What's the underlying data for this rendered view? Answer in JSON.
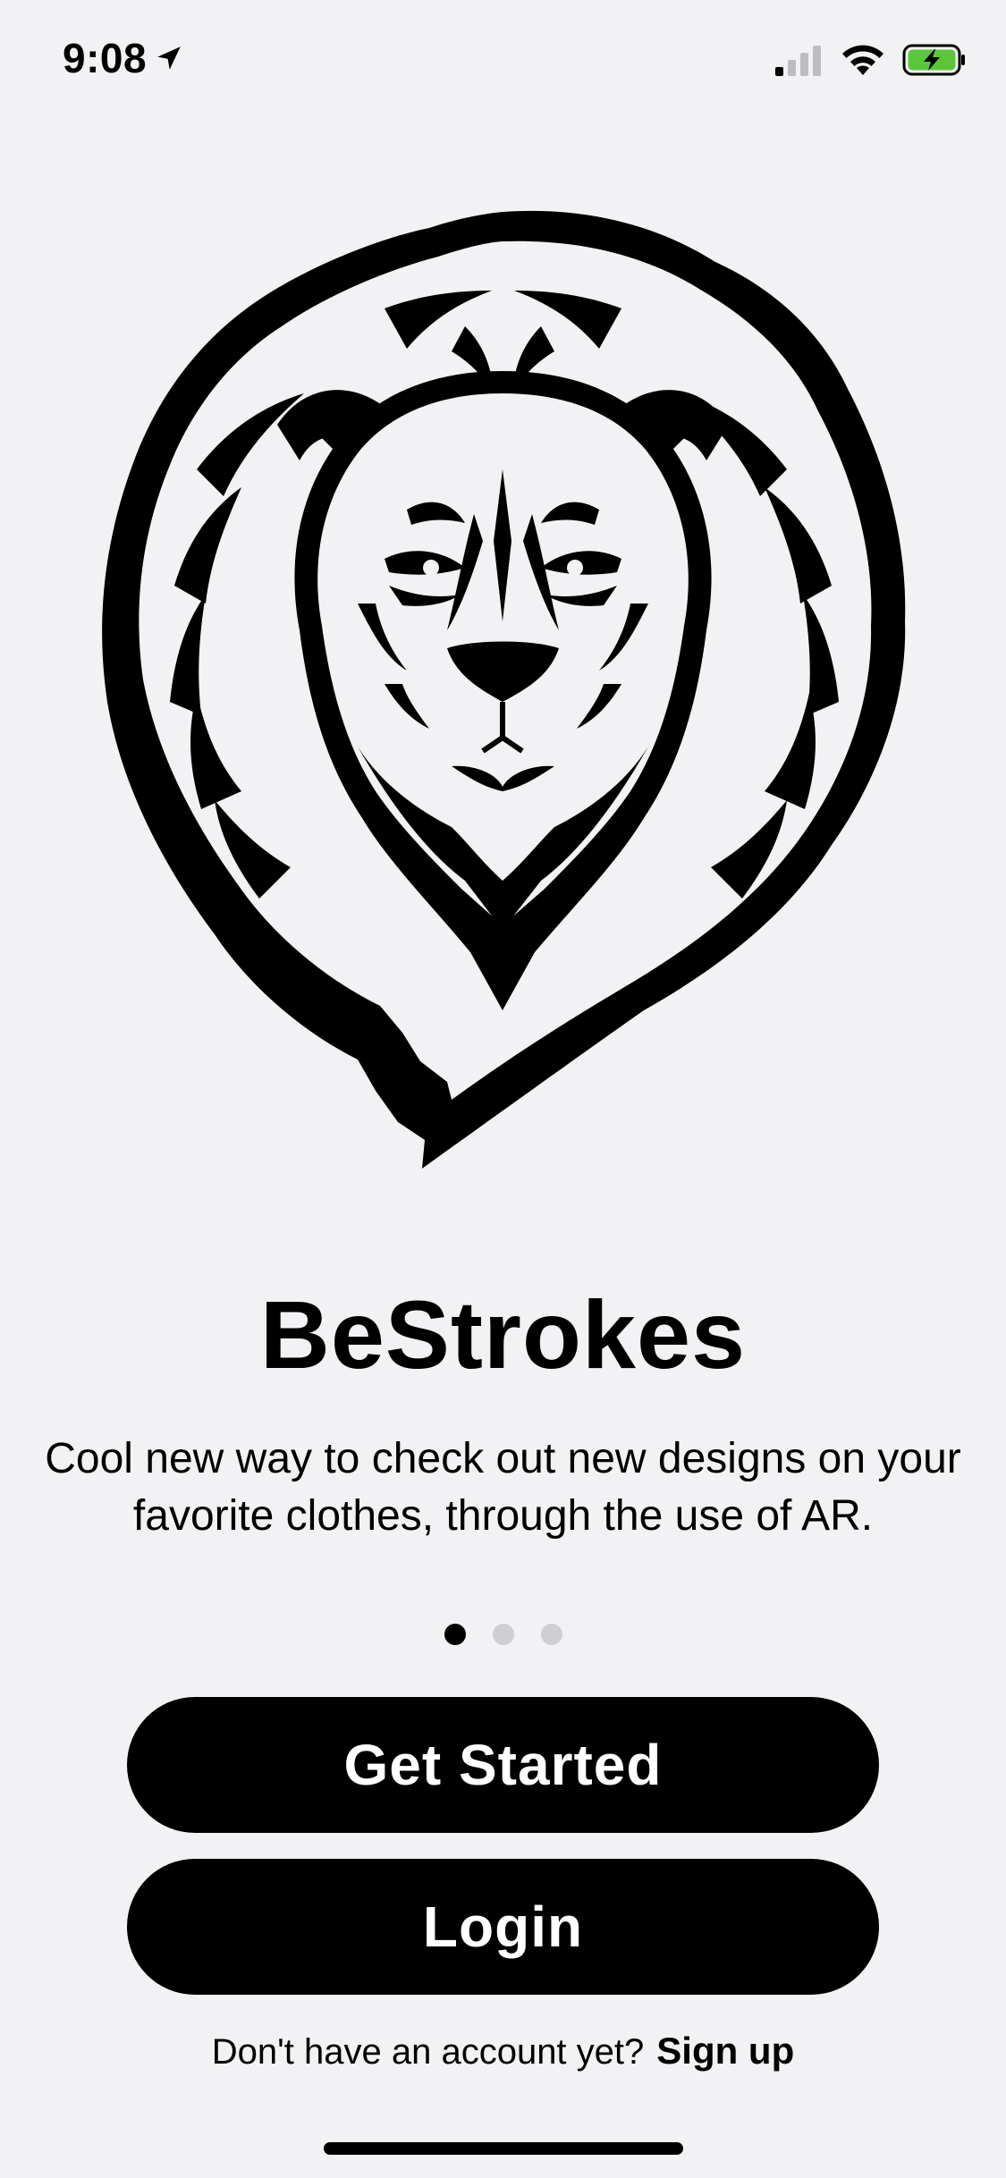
{
  "status_bar": {
    "time": "9:08",
    "battery_color": "#5ac73a"
  },
  "app": {
    "title": "BeStrokes",
    "tagline": "Cool new way to check out new designs on your favorite clothes, through the use of AR."
  },
  "pager": {
    "current_page": 1,
    "total_pages": 3
  },
  "buttons": {
    "get_started": "Get Started",
    "login": "Login"
  },
  "signup": {
    "prompt": "Don't have an account yet?",
    "link": "Sign up"
  }
}
